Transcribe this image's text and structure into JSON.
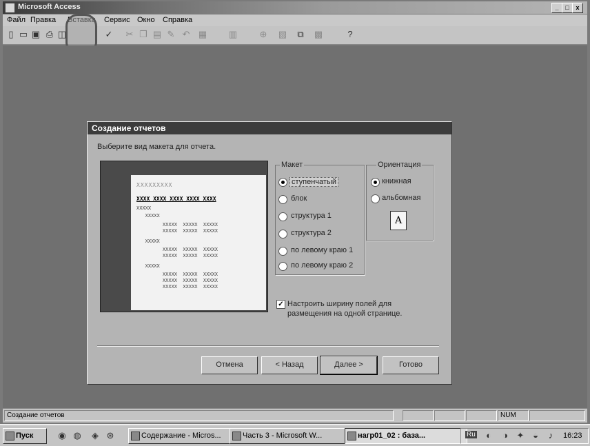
{
  "app": {
    "title": "Microsoft Access",
    "controls": [
      "_",
      "□",
      "x"
    ]
  },
  "menu": [
    "Файл",
    "Правка",
    "Вставка",
    "Сервис",
    "Окно",
    "Справка"
  ],
  "toolbar_icons": [
    "new-icon",
    "open-icon",
    "save-icon",
    "print-icon",
    "preview-icon",
    "spell-icon",
    "cut-icon",
    "copy-icon",
    "paste-icon",
    "format-painter-icon",
    "undo-icon",
    "view-icon",
    "setup-icon",
    "zoom-icon",
    "properties-icon",
    "relationships-icon",
    "new-object-icon",
    "help-icon"
  ],
  "dialog": {
    "title": "Создание отчетов",
    "prompt": "Выберите вид макета для отчета.",
    "layout_group": {
      "label": "Макет",
      "options": [
        "ступенчатый",
        "блок",
        "структура 1",
        "структура 2",
        "по левому краю 1",
        "по левому краю 2"
      ],
      "selected": 0
    },
    "orientation_group": {
      "label": "Ориентация",
      "options": [
        "книжная",
        "альбомная"
      ],
      "selected": 0,
      "page_icon_letter": "A"
    },
    "fit_checkbox": {
      "label_line1": "Настроить ширину полей для",
      "label_line2": "размещения на одной странице.",
      "checked": true
    },
    "preview": {
      "title_row": "XXXXXXXXX",
      "header_row": "XXXX XXXX XXXX XXXX XXXX",
      "lines": [
        "XXXXX",
        "   XXXXX",
        "         XXXXX  XXXXX  XXXXX",
        "         XXXXX  XXXXX  XXXXX",
        "   XXXXX",
        "         XXXXX  XXXXX  XXXXX",
        "         XXXXX  XXXXX  XXXXX",
        "   XXXXX",
        "         XXXXX  XXXXX  XXXXX",
        "         XXXXX  XXXXX  XXXXX",
        "         XXXXX  XXXXX  XXXXX"
      ]
    },
    "buttons": {
      "cancel": "Отмена",
      "back": "< Назад",
      "next": "Далее >",
      "finish": "Готово"
    }
  },
  "statusbar": {
    "text": "Создание отчетов",
    "num": "NUM"
  },
  "taskbar": {
    "start": "Пуск",
    "tasks": [
      "Содержание - Micros...",
      "Часть 3 - Microsoft W...",
      "нагр01_02 : база..."
    ],
    "active_task": 2,
    "clock": "16:23",
    "lang": "Ru"
  }
}
